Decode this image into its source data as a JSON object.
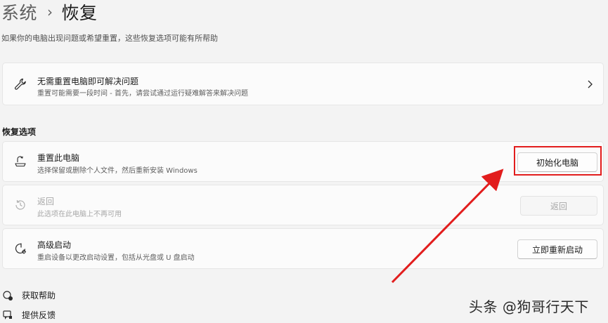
{
  "breadcrumb": {
    "parent": "系统",
    "separator": "›",
    "current": "恢复"
  },
  "subtitle": "如果你的电脑出现问题或希望重置，这些恢复选项可能有所帮助",
  "fix_card": {
    "title": "无需重置电脑即可解决问题",
    "description": "重置可能需要一段时间 - 首先，请尝试通过运行疑难解答来解决问题"
  },
  "section_title": "恢复选项",
  "recovery_options": {
    "reset": {
      "title": "重置此电脑",
      "description": "选择保留或删除个人文件，然后重新安装 Windows",
      "button": "初始化电脑"
    },
    "go_back": {
      "title": "返回",
      "description": "此选项在此电脑上不再可用",
      "button": "返回",
      "enabled": false
    },
    "advanced": {
      "title": "高级启动",
      "description": "重启设备以更改启动设置，包括从光盘或 U 盘启动",
      "button": "立即重新启动"
    }
  },
  "links": {
    "help": "获取帮助",
    "feedback": "提供反馈"
  },
  "annotation": {
    "color": "#e21d1d",
    "target": "初始化电脑"
  },
  "watermark": "头条 @狗哥行天下",
  "icons": [
    "wrench-icon",
    "reset-pc-icon",
    "history-icon",
    "advanced-startup-icon",
    "chevron-right-icon",
    "help-icon",
    "feedback-icon"
  ]
}
